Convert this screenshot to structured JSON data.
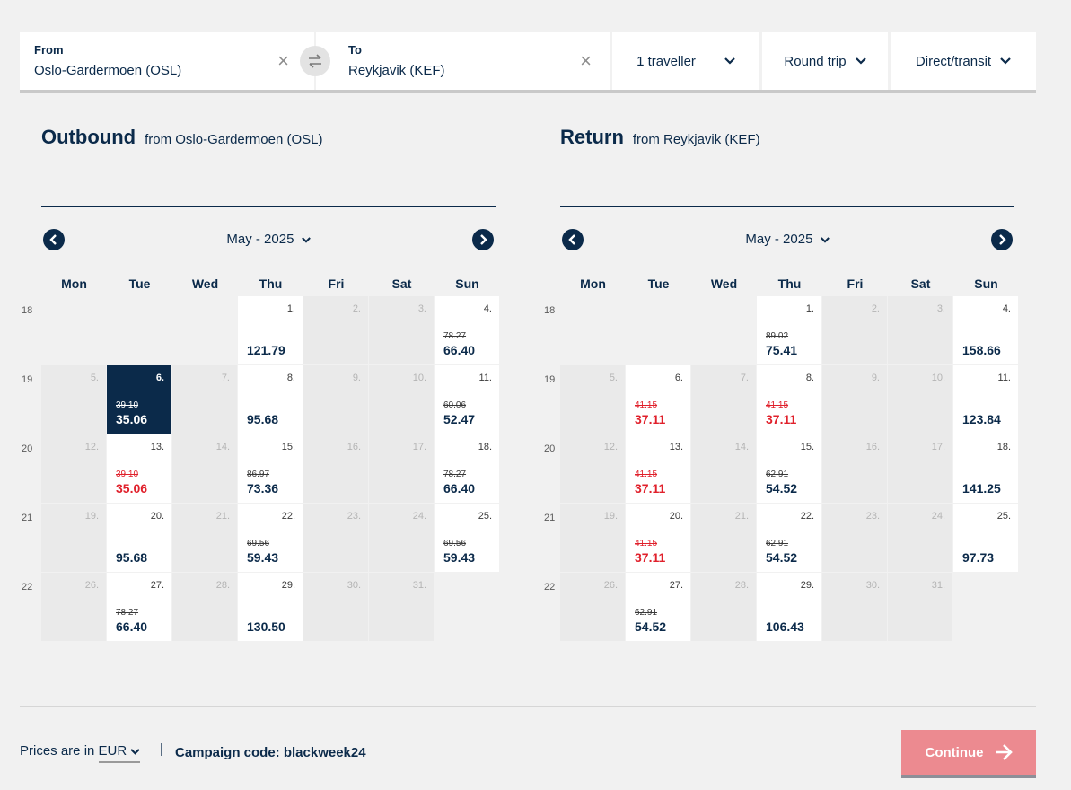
{
  "search": {
    "from_label": "From",
    "from_value": "Oslo-Gardermoen (OSL)",
    "to_label": "To",
    "to_value": "Reykjavik (KEF)",
    "travellers": "1 traveller",
    "trip_type": "Round trip",
    "stops": "Direct/transit"
  },
  "days_of_week": [
    "Mon",
    "Tue",
    "Wed",
    "Thu",
    "Fri",
    "Sat",
    "Sun"
  ],
  "week_numbers": [
    "18",
    "19",
    "20",
    "21",
    "22"
  ],
  "outbound": {
    "title": "Outbound",
    "subtitle": "from Oslo-Gardermoen (OSL)",
    "month": "May - 2025",
    "days": [
      {
        "day": "1.",
        "price": "121.79"
      },
      {
        "day": "2."
      },
      {
        "day": "3."
      },
      {
        "day": "4.",
        "old": "78.27",
        "price": "66.40"
      },
      {
        "day": "5."
      },
      {
        "day": "6.",
        "old": "39.10",
        "price": "35.06",
        "selected": true
      },
      {
        "day": "7."
      },
      {
        "day": "8.",
        "price": "95.68"
      },
      {
        "day": "9."
      },
      {
        "day": "10."
      },
      {
        "day": "11.",
        "old": "60.06",
        "price": "52.47"
      },
      {
        "day": "12."
      },
      {
        "day": "13.",
        "old": "39.10",
        "price": "35.06",
        "red": true
      },
      {
        "day": "14."
      },
      {
        "day": "15.",
        "old": "86.97",
        "price": "73.36"
      },
      {
        "day": "16."
      },
      {
        "day": "17."
      },
      {
        "day": "18.",
        "old": "78.27",
        "price": "66.40"
      },
      {
        "day": "19."
      },
      {
        "day": "20.",
        "price": "95.68"
      },
      {
        "day": "21."
      },
      {
        "day": "22.",
        "old": "69.56",
        "price": "59.43"
      },
      {
        "day": "23."
      },
      {
        "day": "24."
      },
      {
        "day": "25.",
        "old": "69.56",
        "price": "59.43"
      },
      {
        "day": "26."
      },
      {
        "day": "27.",
        "old": "78.27",
        "price": "66.40"
      },
      {
        "day": "28."
      },
      {
        "day": "29.",
        "price": "130.50"
      },
      {
        "day": "30."
      },
      {
        "day": "31."
      }
    ]
  },
  "return": {
    "title": "Return",
    "subtitle": "from Reykjavik (KEF)",
    "month": "May - 2025",
    "days": [
      {
        "day": "1.",
        "old": "89.02",
        "price": "75.41"
      },
      {
        "day": "2."
      },
      {
        "day": "3."
      },
      {
        "day": "4.",
        "price": "158.66"
      },
      {
        "day": "5."
      },
      {
        "day": "6.",
        "old": "41.15",
        "price": "37.11",
        "red": true
      },
      {
        "day": "7."
      },
      {
        "day": "8.",
        "old": "41.15",
        "price": "37.11",
        "red": true
      },
      {
        "day": "9."
      },
      {
        "day": "10."
      },
      {
        "day": "11.",
        "price": "123.84"
      },
      {
        "day": "12."
      },
      {
        "day": "13.",
        "old": "41.15",
        "price": "37.11",
        "red": true
      },
      {
        "day": "14."
      },
      {
        "day": "15.",
        "old": "62.91",
        "price": "54.52"
      },
      {
        "day": "16."
      },
      {
        "day": "17."
      },
      {
        "day": "18.",
        "price": "141.25"
      },
      {
        "day": "19."
      },
      {
        "day": "20.",
        "old": "41.15",
        "price": "37.11",
        "red": true
      },
      {
        "day": "21."
      },
      {
        "day": "22.",
        "old": "62.91",
        "price": "54.52"
      },
      {
        "day": "23."
      },
      {
        "day": "24."
      },
      {
        "day": "25.",
        "price": "97.73"
      },
      {
        "day": "26."
      },
      {
        "day": "27.",
        "old": "62.91",
        "price": "54.52"
      },
      {
        "day": "28."
      },
      {
        "day": "29.",
        "price": "106.43"
      },
      {
        "day": "30."
      },
      {
        "day": "31."
      }
    ]
  },
  "footer": {
    "prices_label": "Prices are in",
    "currency": "EUR",
    "separator": "|",
    "campaign": "Campaign code: blackweek24",
    "continue_label": "Continue"
  },
  "colors": {
    "navy": "#0b2a4a",
    "discount_red": "#e0202b",
    "continue_button": "#ec8a90"
  },
  "icons": {
    "clear": "close-icon",
    "swap": "swap-arrows-icon",
    "dropdown": "chevron-down-icon",
    "prev": "chevron-left-icon",
    "next": "chevron-right-icon",
    "continue": "arrow-right-icon"
  }
}
